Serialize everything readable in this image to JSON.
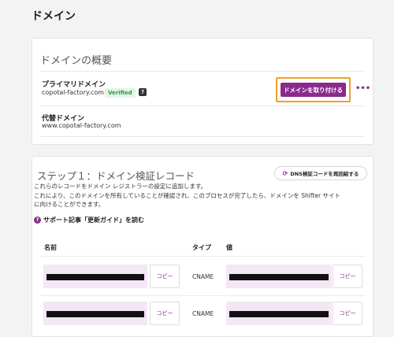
{
  "page": {
    "title": "ドメイン"
  },
  "overview": {
    "heading": "ドメインの概要",
    "primary": {
      "label": "プライマリドメイン",
      "domain": "copotal-factory.com",
      "badge": "Verified",
      "help_glyph": "?"
    },
    "attach_button": "ドメインを取り付ける",
    "more_glyph": "•••",
    "alias": {
      "label": "代替ドメイン",
      "domain": "www.copotal-factory.com"
    }
  },
  "step": {
    "heading": "ステップ１：ドメイン検証レコード",
    "recheck_button": "DNS検証コードを再回紹する",
    "refresh_glyph": "⟳",
    "desc_line1": "これらのレコードをドメイン レジストラーの設定に追加します。",
    "desc_line2": "これにより、このドメインを所有していることが確認され、このプロセスが完了したら、ドメインを Shifter サイト",
    "desc_line3": "に向けることができます。",
    "support_link": "サポート記事「更新ガイド」を読む",
    "support_icon": "?",
    "columns": {
      "name": "名前",
      "type": "タイプ",
      "value": "値"
    },
    "records": [
      {
        "type": "CNAME",
        "copy_label": "コピー",
        "copy_label_value": "コピー"
      },
      {
        "type": "CNAME",
        "copy_label": "コピー",
        "copy_label_value": "コピー"
      }
    ]
  },
  "colors": {
    "accent": "#8b2a8d",
    "highlight": "#f0a029",
    "verified": "#2a9d4e",
    "field_bg": "#f5e6f5"
  }
}
